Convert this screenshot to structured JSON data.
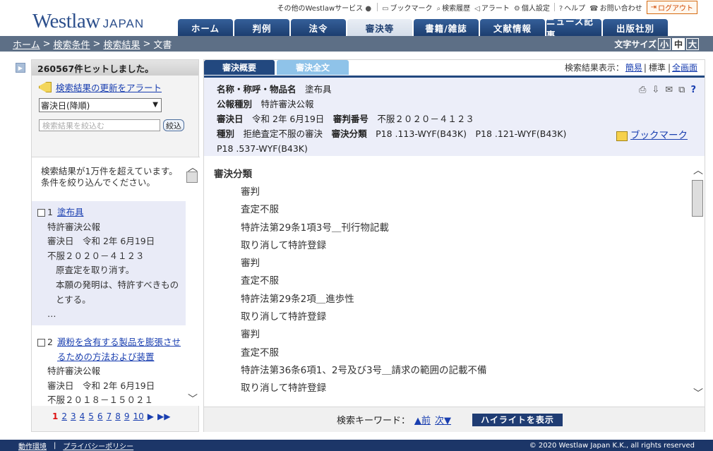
{
  "logo": {
    "text": "Westlaw",
    "suffix": "JAPAN"
  },
  "util": {
    "other_services": "その他のWestlawサービス",
    "bookmark": "ブックマーク",
    "history": "検索履歴",
    "alert": "アラート",
    "settings": "個人設定",
    "help": "ヘルプ",
    "contact": "お問い合わせ",
    "logout": "ログアウト"
  },
  "nav": {
    "tabs": [
      {
        "label": "ホーム"
      },
      {
        "label": "判例"
      },
      {
        "label": "法令"
      },
      {
        "label": "審決等"
      },
      {
        "label": "書籍/雑誌"
      },
      {
        "label": "文献情報"
      },
      {
        "label": "ニュース記事"
      },
      {
        "label": "出版社別"
      }
    ],
    "active": "審決等"
  },
  "breadcrumb": {
    "home": "ホーム",
    "cond": "検索条件",
    "results": "検索結果",
    "current": "文書",
    "sep": ">"
  },
  "fontsize": {
    "label": "文字サイズ",
    "small": "小",
    "medium": "中",
    "large": "大"
  },
  "left": {
    "hits": "260567件ヒットしました。",
    "alert_link": "検索結果の更新をアラート",
    "sort": "審決日(降順)",
    "narrow_placeholder": "検索結果を絞込む",
    "narrow_btn": "絞込",
    "note": "検索結果が1万件を超えています。条件を絞り込んでください。",
    "items": [
      {
        "num": "1",
        "title": "塗布具",
        "type": "特許審決公報",
        "date": "審決日　令和 2年 6月19日",
        "case": "不服２０２０－４１２３",
        "summary1": "原査定を取り消す。",
        "summary2": "本願の発明は、特許すべきものとする。",
        "more": "…"
      },
      {
        "num": "2",
        "title": "澱粉を含有する製品を膨張させるための方法および装置",
        "type": "特許審決公報",
        "date": "審決日　令和 2年 6月19日",
        "case": "不服２０１８－１５０２１"
      }
    ],
    "pages": [
      "1",
      "2",
      "3",
      "4",
      "5",
      "6",
      "7",
      "8",
      "9",
      "10"
    ],
    "cur_page": "1",
    "next": "▶",
    "last": "▶▶"
  },
  "right": {
    "tab_summary": "審決概要",
    "tab_full": "審決全文",
    "view_label": "検索結果表示：",
    "view_simple": "簡易",
    "view_std": "標準",
    "view_full": "全画面",
    "name_label": "名称・称呼・物品名",
    "name_value": "塗布具",
    "pubtype_label": "公報種別",
    "pubtype_value": "特許審決公報",
    "date_label": "審決日",
    "date_value": "令和 2年 6月19日",
    "num_label": "審判番号",
    "num_value": "不服２０２０－４１２３",
    "kind_label": "種別",
    "kind_value": "拒絶査定不服の審決",
    "class_label": "審決分類",
    "class_value": "P18 .113-WYF(B43K)　P18 .121-WYF(B43K)",
    "class_value2": "P18 .537-WYF(B43K)",
    "bookmark": "ブックマーク",
    "section_title": "審決分類",
    "lines": [
      "審判",
      "査定不服",
      "特許法第29条1項3号＿刊行物記載",
      "取り消して特許登録",
      "審判",
      "査定不服",
      "特許法第29条2項＿進歩性",
      "取り消して特許登録",
      "審判",
      "査定不服",
      "特許法第36条6項1、2号及び3号＿請求の範囲の記載不備",
      "取り消して特許登録"
    ],
    "kw_label": "検索キーワード：",
    "kw_prev": "▲前",
    "kw_next": "次▼",
    "highlight": "ハイライトを表示"
  },
  "footer": {
    "env": "動作環境",
    "privacy": "プライバシーポリシー",
    "copyright": "© 2020 Westlaw Japan K.K., all rights reserved"
  }
}
